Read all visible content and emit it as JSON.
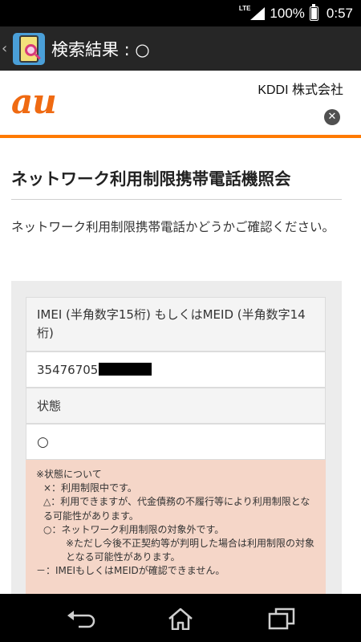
{
  "statusbar": {
    "network": "LTE",
    "battery": "100%",
    "battery_level": 1.0,
    "time": "0:57"
  },
  "actionbar": {
    "title": "検索結果 : ○"
  },
  "header": {
    "logo": "au",
    "company": "KDDI 株式会社",
    "close_glyph": "✕"
  },
  "page": {
    "title": "ネットワーク利用制限携帯電話機照会",
    "intro": "ネットワーク利用制限携帯電話かどうかご確認ください。"
  },
  "result": {
    "imei_label": "IMEI (半角数字15桁) もしくはMEID (半角数字14桁)",
    "imei_value": "35476705",
    "status_label": "状態",
    "status_value": "○"
  },
  "notes": {
    "heading": "※状態について",
    "items": [
      "×：利用制限中です。",
      "△：利用できますが、代金債務の不履行等により利用制限となる可能性があります。",
      "○：ネットワーク利用制限の対象外です。",
      "※ただし今後不正契約等が判明した場合は利用制限の対象となる可能性があります。",
      "－：IMEIもしくはMEIDが確認できません。"
    ]
  },
  "colors": {
    "accent_orange": "#ff7a00",
    "au_logo": "#ef6a12",
    "notes_background": "#f5d6c8",
    "actionbar": "#262626"
  },
  "icons": [
    "signal-icon",
    "battery-icon",
    "app-icon",
    "close-icon",
    "back-icon",
    "home-icon",
    "recent-apps-icon"
  ]
}
